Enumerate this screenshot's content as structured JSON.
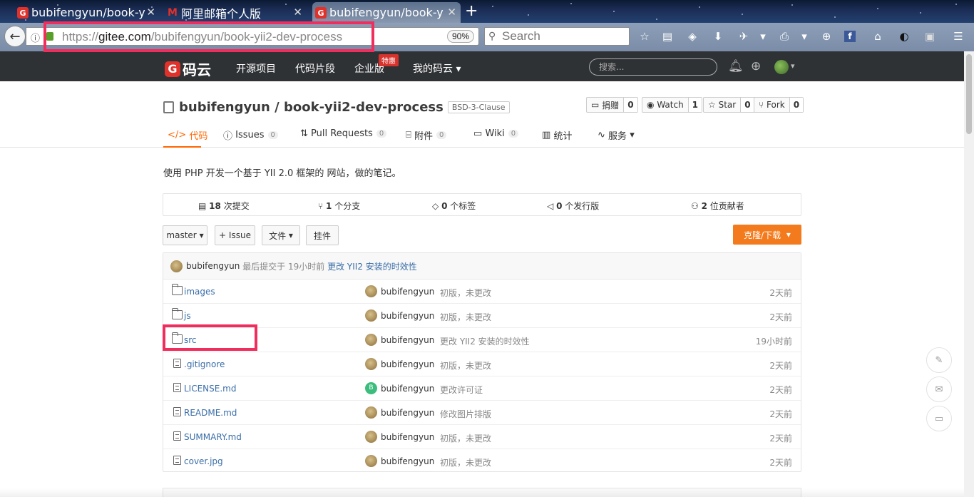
{
  "browser": {
    "tabs": [
      {
        "title": "bubifengyun/book-y",
        "icon": "gitee-icon",
        "active": false
      },
      {
        "title": "阿里邮箱个人版",
        "icon": "aliyun-mail-icon",
        "active": false
      },
      {
        "title": "bubifengyun/book-y",
        "icon": "gitee-icon",
        "active": true
      }
    ],
    "url_prefix": "https://",
    "url_host": "gitee.com",
    "url_path": "/bubifengyun/book-yii2-dev-process",
    "zoom": "90%",
    "search_placeholder": "Search"
  },
  "site": {
    "logo_text": "码云",
    "logo_letter": "G",
    "nav": [
      "开源项目",
      "代码片段",
      "企业版",
      "我的码云"
    ],
    "enterprise_badge": "特惠",
    "search_placeholder": "搜索..."
  },
  "repo": {
    "owner": "bubifengyun",
    "separator": "/",
    "name": "book-yii2-dev-process",
    "license": "BSD-3-Clause",
    "actions": [
      {
        "label": "捐赠",
        "count": "0"
      },
      {
        "label": "Watch",
        "count": "1"
      },
      {
        "label": "Star",
        "count": "0"
      },
      {
        "label": "Fork",
        "count": "0"
      }
    ],
    "tabs": [
      {
        "label": "代码",
        "count": null,
        "active": true
      },
      {
        "label": "Issues",
        "count": "0"
      },
      {
        "label": "Pull Requests",
        "count": "0"
      },
      {
        "label": "附件",
        "count": "0"
      },
      {
        "label": "Wiki",
        "count": "0"
      },
      {
        "label": "统计",
        "count": null
      },
      {
        "label": "服务",
        "count": null
      }
    ],
    "description": "使用 PHP 开发一个基于 YII 2.0 框架的 网站，做的笔记。",
    "stats": [
      {
        "num": "18",
        "label": "次提交"
      },
      {
        "num": "1",
        "label": "个分支"
      },
      {
        "num": "0",
        "label": "个标签"
      },
      {
        "num": "0",
        "label": "个发行版"
      },
      {
        "num": "2",
        "label": "位贡献者"
      }
    ],
    "toolbar": {
      "branch": "master",
      "issue": "+ Issue",
      "file": "文件",
      "widget": "挂件",
      "clone": "克隆/下载"
    },
    "last_commit": {
      "author": "bubifengyun",
      "prefix": "最后提交于",
      "time": "19小时前",
      "message": "更改 YII2 安装的时效性"
    },
    "files": [
      {
        "name": "images",
        "type": "folder",
        "author": "bubifengyun",
        "avatar": "photo",
        "message": "初版，未更改",
        "time": "2天前"
      },
      {
        "name": "js",
        "type": "folder",
        "author": "bubifengyun",
        "avatar": "photo",
        "message": "初版，未更改",
        "time": "2天前"
      },
      {
        "name": "src",
        "type": "folder",
        "author": "bubifengyun",
        "avatar": "photo",
        "message": "更改 YII2 安装的时效性",
        "time": "19小时前"
      },
      {
        "name": ".gitignore",
        "type": "file",
        "author": "bubifengyun",
        "avatar": "photo",
        "message": "初版，未更改",
        "time": "2天前"
      },
      {
        "name": "LICENSE.md",
        "type": "file",
        "author": "bubifengyun",
        "avatar": "B",
        "message": "更改许可证",
        "time": "2天前"
      },
      {
        "name": "README.md",
        "type": "file",
        "author": "bubifengyun",
        "avatar": "photo",
        "message": "修改图片排版",
        "time": "2天前"
      },
      {
        "name": "SUMMARY.md",
        "type": "file",
        "author": "bubifengyun",
        "avatar": "photo",
        "message": "初版，未更改",
        "time": "2天前"
      },
      {
        "name": "cover.jpg",
        "type": "file",
        "author": "bubifengyun",
        "avatar": "photo",
        "message": "初版，未更改",
        "time": "2天前"
      }
    ]
  },
  "colors": {
    "accent": "#f37b1d",
    "highlight": "#f02d5d",
    "header_bg": "#2f3235",
    "link": "#3a6ea8"
  }
}
